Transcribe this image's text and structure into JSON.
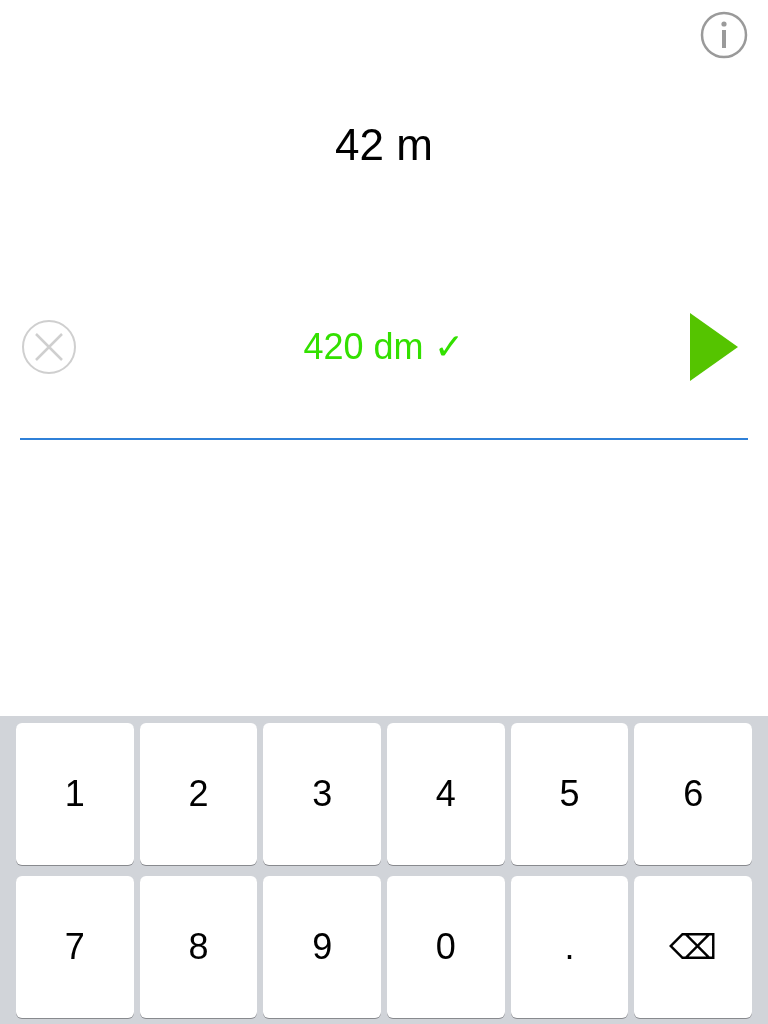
{
  "question": {
    "text": "42 m"
  },
  "answer": {
    "value": "420 dm ✓",
    "correct": true
  },
  "keyboard": {
    "keys": [
      {
        "label": "1",
        "kind": "digit"
      },
      {
        "label": "2",
        "kind": "digit"
      },
      {
        "label": "3",
        "kind": "digit"
      },
      {
        "label": "4",
        "kind": "digit"
      },
      {
        "label": "5",
        "kind": "digit"
      },
      {
        "label": "6",
        "kind": "digit"
      },
      {
        "label": "7",
        "kind": "digit"
      },
      {
        "label": "8",
        "kind": "digit"
      },
      {
        "label": "9",
        "kind": "digit"
      },
      {
        "label": "0",
        "kind": "digit"
      },
      {
        "label": ".",
        "kind": "digit"
      },
      {
        "label": "⌫",
        "kind": "backspace"
      }
    ]
  }
}
